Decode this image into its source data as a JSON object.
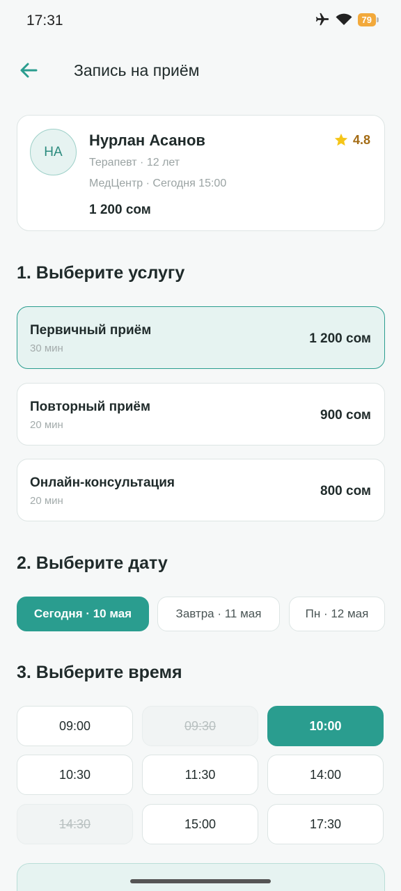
{
  "status": {
    "time": "17:31",
    "battery": "79",
    "icons": [
      "airplane-icon",
      "wifi-icon",
      "battery-icon"
    ]
  },
  "header": {
    "title": "Запись на приём"
  },
  "doctor": {
    "initials": "НА",
    "name": "Нурлан Асанов",
    "specialty": "Терапевт · 12 лет",
    "clinic": "МедЦентр · Сегодня 15:00",
    "price": "1 200 сом",
    "rating": "4.8"
  },
  "sections": {
    "service": "1. Выберите услугу",
    "date": "2. Выберите дату",
    "time": "3. Выберите время"
  },
  "services": [
    {
      "name": "Первичный приём",
      "duration": "30 мин",
      "price": "1 200 сом",
      "selected": true
    },
    {
      "name": "Повторный приём",
      "duration": "20 мин",
      "price": "900 сом",
      "selected": false
    },
    {
      "name": "Онлайн-консультация",
      "duration": "20 мин",
      "price": "800 сом",
      "selected": false
    }
  ],
  "dates": [
    {
      "label": "Сегодня · 10 мая",
      "selected": true
    },
    {
      "label": "Завтра · 11 мая",
      "selected": false
    },
    {
      "label": "Пн · 12 мая",
      "selected": false
    }
  ],
  "slots": [
    {
      "time": "09:00",
      "state": "available"
    },
    {
      "time": "09:30",
      "state": "disabled"
    },
    {
      "time": "10:00",
      "state": "selected"
    },
    {
      "time": "10:30",
      "state": "available"
    },
    {
      "time": "11:30",
      "state": "available"
    },
    {
      "time": "14:00",
      "state": "available"
    },
    {
      "time": "14:30",
      "state": "disabled"
    },
    {
      "time": "15:00",
      "state": "available"
    },
    {
      "time": "17:30",
      "state": "available"
    }
  ],
  "colors": {
    "accent": "#2a9d8f",
    "selected_bg": "#e6f3f1",
    "star": "#f5c518",
    "battery": "#f2a93b"
  }
}
